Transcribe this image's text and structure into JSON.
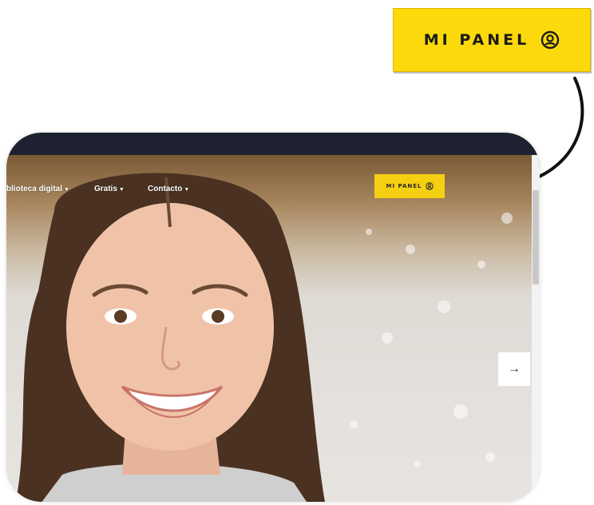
{
  "callout": {
    "label": "MI PANEL",
    "icon": "user-circle-icon",
    "color": "#fcd90a"
  },
  "site": {
    "nav": [
      {
        "label": "blioteca digital",
        "has_dropdown": true
      },
      {
        "label": "Gratis",
        "has_dropdown": true
      },
      {
        "label": "Contacto",
        "has_dropdown": true
      }
    ],
    "panel_button": {
      "label": "MI PANEL",
      "icon": "user-circle-icon",
      "color": "#f5cf12"
    },
    "next_button": {
      "glyph": "→",
      "icon": "arrow-right-icon"
    }
  }
}
